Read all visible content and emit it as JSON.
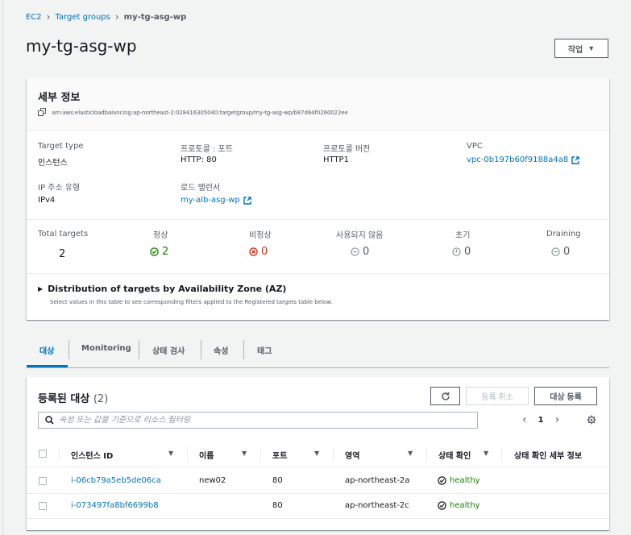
{
  "breadcrumb": {
    "items": [
      "EC2",
      "Target groups"
    ],
    "current": "my-tg-asg-wp"
  },
  "page_title": "my-tg-asg-wp",
  "actions_label": "작업",
  "details": {
    "title": "세부 정보",
    "arn": "arn:aws:elasticloadbalancing:ap-northeast-2:028416305040:targetgroup/my-tg-asg-wp/b87d84f0260022ee",
    "target_type_label": "Target type",
    "target_type_value": "인스턴스",
    "protocol_port_label": "프로토콜 : 포트",
    "protocol_port_value": "HTTP: 80",
    "protocol_version_label": "프로토콜 버전",
    "protocol_version_value": "HTTP1",
    "vpc_label": "VPC",
    "vpc_value": "vpc-0b197b60f9188a4a8",
    "ip_type_label": "IP 주소 유형",
    "ip_type_value": "IPv4",
    "lb_label": "로드 밸런서",
    "lb_value": "my-alb-asg-wp"
  },
  "stats": {
    "total_label": "Total targets",
    "total_value": "2",
    "healthy_label": "정상",
    "healthy_value": "2",
    "unhealthy_label": "비정상",
    "unhealthy_value": "0",
    "unused_label": "사용되지 않음",
    "unused_value": "0",
    "initial_label": "초기",
    "initial_value": "0",
    "draining_label": "Draining",
    "draining_value": "0"
  },
  "distribution": {
    "title": "Distribution of targets by Availability Zone (AZ)",
    "subtitle": "Select values in this table to see corresponding filters applied to the Registered targets table below."
  },
  "tabs": [
    "대상",
    "Monitoring",
    "상태 검사",
    "속성",
    "태그"
  ],
  "targets": {
    "title": "등록된 대상",
    "count": "(2)",
    "deregister_label": "등록 취소",
    "register_label": "대상 등록",
    "search_placeholder": "속성 또는 값을 기준으로 리소스 필터링",
    "page": "1",
    "columns": [
      "인스턴스 ID",
      "이름",
      "포트",
      "영역",
      "상태 확인",
      "상태 확인 세부 정보"
    ],
    "rows": [
      {
        "id": "i-06cb79a5eb5de06ca",
        "name": "new02",
        "port": "80",
        "zone": "ap-northeast-2a",
        "health": "healthy"
      },
      {
        "id": "i-073497fa8bf6699b8",
        "name": "",
        "port": "80",
        "zone": "ap-northeast-2c",
        "health": "healthy"
      }
    ]
  },
  "colors": {
    "link": "#0073bb",
    "healthy": "#1d8102",
    "unhealthy": "#d13212",
    "muted": "#545b64"
  }
}
